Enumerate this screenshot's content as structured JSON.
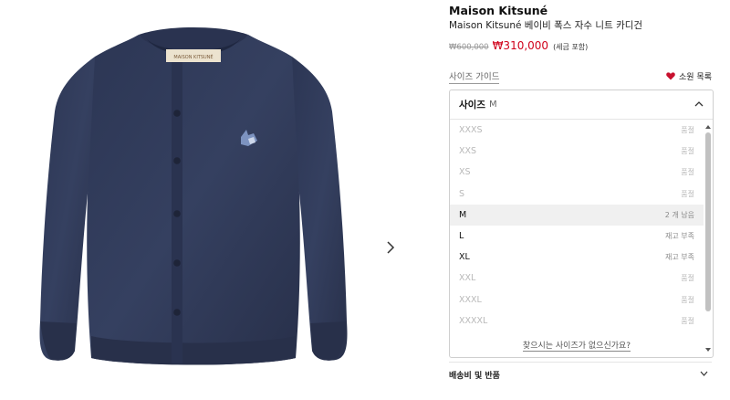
{
  "product": {
    "brand": "Maison Kitsuné",
    "name": "Maison Kitsuné 베이비 폭스 자수 니트 카디건",
    "old_price": "₩600,000",
    "sale_price": "₩310,000",
    "tax_note": "(세금 포함)",
    "image_label": "MAISON KITSUNÉ"
  },
  "links": {
    "size_guide": "사이즈 가이드",
    "wishlist": "소원 목록"
  },
  "size_select": {
    "label": "사이즈",
    "selected": "M",
    "options": [
      {
        "size": "XXXS",
        "status": "품절"
      },
      {
        "size": "XXS",
        "status": "품절"
      },
      {
        "size": "XS",
        "status": "품절"
      },
      {
        "size": "S",
        "status": "품절"
      },
      {
        "size": "M",
        "status": "2 개 남음"
      },
      {
        "size": "L",
        "status": "재고 부족"
      },
      {
        "size": "XL",
        "status": "재고 부족"
      },
      {
        "size": "XXL",
        "status": "품절"
      },
      {
        "size": "XXXL",
        "status": "품절"
      },
      {
        "size": "XXXXL",
        "status": "품절"
      }
    ],
    "help_link": "찾으시는 사이즈가 없으신가요?"
  },
  "accordion": {
    "shipping_returns": "배송비 및 반품"
  },
  "colors": {
    "sale": "#d0021b",
    "heart": "#c8102e",
    "garment": "#2f3a55"
  }
}
